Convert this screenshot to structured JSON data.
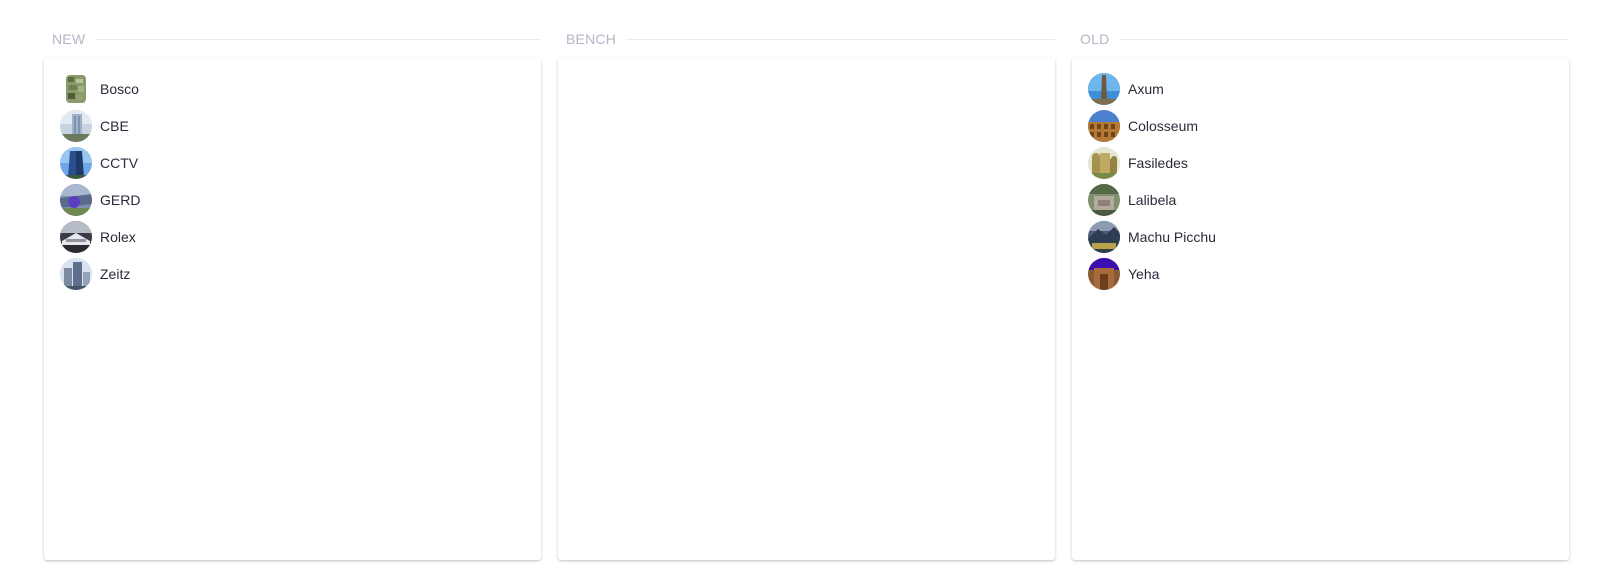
{
  "columns": [
    {
      "title": "NEW",
      "items": [
        {
          "label": "Bosco",
          "icon": "bosco-photo-icon"
        },
        {
          "label": "CBE",
          "icon": "cbe-photo-icon"
        },
        {
          "label": "CCTV",
          "icon": "cctv-photo-icon"
        },
        {
          "label": "GERD",
          "icon": "gerd-photo-icon"
        },
        {
          "label": "Rolex",
          "icon": "rolex-photo-icon"
        },
        {
          "label": "Zeitz",
          "icon": "zeitz-photo-icon"
        }
      ]
    },
    {
      "title": "BENCH",
      "items": []
    },
    {
      "title": "OLD",
      "items": [
        {
          "label": "Axum",
          "icon": "axum-photo-icon"
        },
        {
          "label": "Colosseum",
          "icon": "colosseum-photo-icon"
        },
        {
          "label": "Fasiledes",
          "icon": "fasiledes-photo-icon"
        },
        {
          "label": "Lalibela",
          "icon": "lalibela-photo-icon"
        },
        {
          "label": "Machu Picchu",
          "icon": "machu-picchu-photo-icon"
        },
        {
          "label": "Yeha",
          "icon": "yeha-photo-icon"
        }
      ]
    }
  ],
  "colors": {
    "header_text": "#b2b6c8",
    "item_text": "#2a2a3a",
    "rule": "#e9ebf0"
  }
}
